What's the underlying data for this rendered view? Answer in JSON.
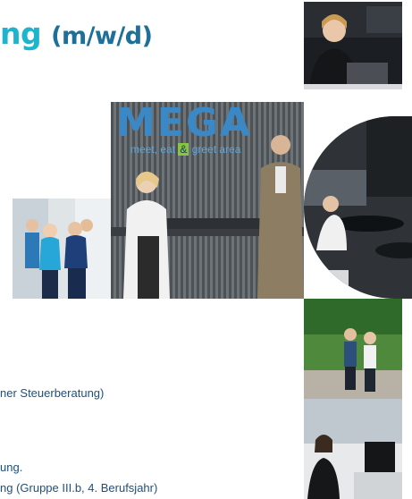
{
  "heading": {
    "part1": "ng",
    "part2": "(m/w/d)"
  },
  "photos": {
    "top_right": "woman-at-desk-photo",
    "mega": {
      "logo": "MEGA",
      "tagline_start": "meet, eat ",
      "tagline_accent": "&",
      "tagline_end": " greet area"
    },
    "team": "team-photo",
    "office": "office-photo",
    "walk": "outdoor-walk-photo",
    "reception": "reception-photo"
  },
  "text_lines": [
    "ner Steuerberatung)",
    "ung.",
    "ng (Gruppe III.b, 4. Berufsjahr)"
  ],
  "colors": {
    "heading_primary": "#1fb4cd",
    "heading_secondary": "#1e6f9a",
    "body_text": "#1d4f82"
  }
}
